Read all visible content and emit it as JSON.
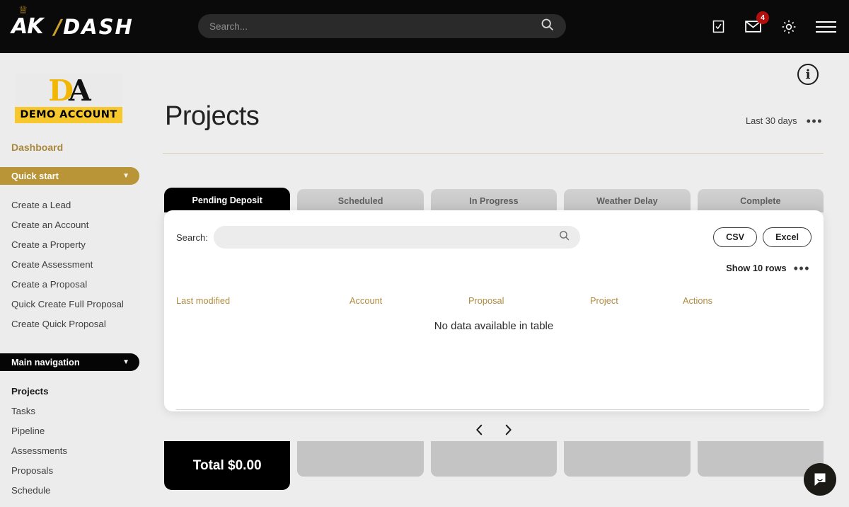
{
  "topbar": {
    "brand_ak": "AK",
    "brand_dash": "DASH",
    "search_placeholder": "Search...",
    "search_value": "",
    "mail_badge": "4",
    "icons": [
      "task-icon",
      "mail-icon",
      "gear-icon",
      "hamburger-icon"
    ]
  },
  "sidebar": {
    "logo_d": "D",
    "logo_a": "A",
    "logo_caption": "DEMO ACCOUNT",
    "dashboard_label": "Dashboard",
    "quick_start": {
      "label": "Quick start",
      "items": [
        "Create a Lead",
        "Create an Account",
        "Create a Property",
        "Create Assessment",
        "Create a Proposal",
        "Quick Create Full Proposal",
        "Create Quick Proposal"
      ]
    },
    "main_navigation": {
      "label": "Main navigation",
      "items": [
        "Projects",
        "Tasks",
        "Pipeline",
        "Assessments",
        "Proposals",
        "Schedule"
      ],
      "active": "Projects"
    }
  },
  "main": {
    "page_title": "Projects",
    "date_range": "Last 30 days",
    "overflow_dots": "•••",
    "info_icon_char": "i",
    "tabs": [
      {
        "label": "Pending Deposit",
        "active": true,
        "total": "Total $0.00"
      },
      {
        "label": "Scheduled",
        "active": false,
        "total": ""
      },
      {
        "label": "In Progress",
        "active": false,
        "total": ""
      },
      {
        "label": "Weather Delay",
        "active": false,
        "total": ""
      },
      {
        "label": "Complete",
        "active": false,
        "total": ""
      }
    ],
    "panel": {
      "search_label": "Search:",
      "search_value": "",
      "search_placeholder": "",
      "csv_label": "CSV",
      "excel_label": "Excel",
      "rows_label": "Show 10 rows",
      "rows_dots": "•••",
      "columns": [
        "Last modified",
        "Account",
        "Proposal",
        "Project",
        "Actions"
      ],
      "empty_message": "No data available in table",
      "prev_label": "‹",
      "next_label": "›"
    }
  },
  "colors": {
    "brand_gold": "#c9a227",
    "sidebar_gold_pill": "#b99537",
    "badge_red": "#b30f0f",
    "table_header_gold": "#b08b3f",
    "logo_yellow": "#f7c82e",
    "active_tab": "#000000",
    "page_bg": "#ededed"
  }
}
